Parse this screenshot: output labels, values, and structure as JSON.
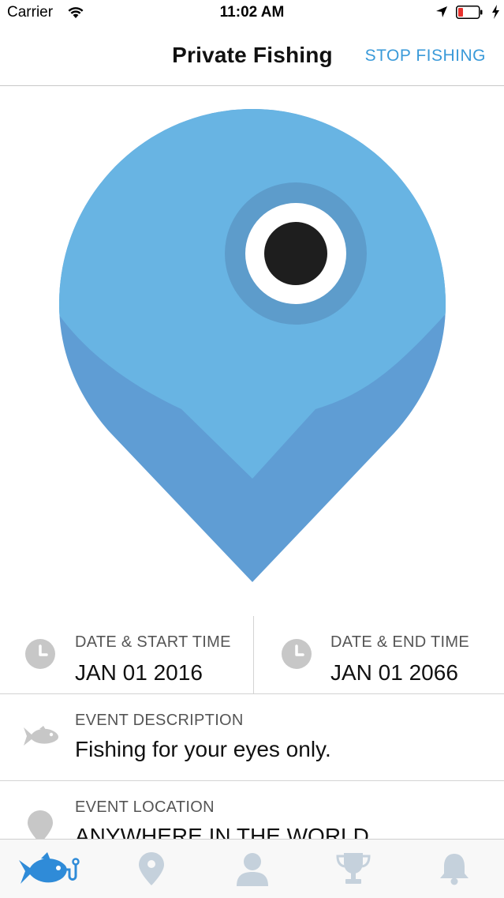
{
  "status_bar": {
    "carrier": "Carrier",
    "time": "11:02 AM",
    "icons": [
      "wifi-icon",
      "location-arrow-icon",
      "battery-low-icon",
      "charging-bolt-icon"
    ]
  },
  "nav": {
    "title": "Private Fishing",
    "action_label": "STOP FISHING"
  },
  "hero": {
    "icon": "fish-eye-map-pin-icon"
  },
  "event": {
    "start_label": "DATE & START TIME",
    "start_value": "JAN 01 2016",
    "end_label": "DATE & END TIME",
    "end_value": "JAN 01 2066",
    "description_label": "EVENT DESCRIPTION",
    "description_value": "Fishing for your eyes only.",
    "location_label": "EVENT LOCATION",
    "location_value": "ANYWHERE IN THE WORLD"
  },
  "tabs": [
    {
      "icon": "fish-hook-icon",
      "active": true
    },
    {
      "icon": "map-pin-icon",
      "active": false
    },
    {
      "icon": "person-icon",
      "active": false
    },
    {
      "icon": "trophy-icon",
      "active": false
    },
    {
      "icon": "bell-icon",
      "active": false
    }
  ],
  "colors": {
    "accent": "#3a9ad9",
    "pin_light": "#68b4e3",
    "pin_dark": "#5f9dd4",
    "icon_gray": "#c7c7c7",
    "tab_icon_gray": "#c5d1dc",
    "tab_active": "#2f8bd8"
  }
}
